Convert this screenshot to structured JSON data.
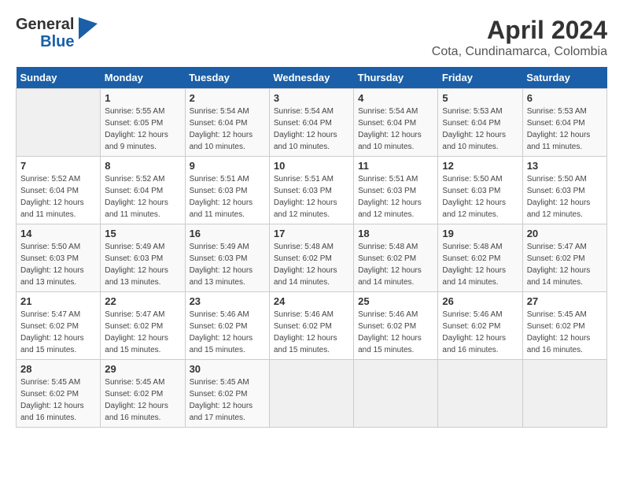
{
  "header": {
    "logo_general": "General",
    "logo_blue": "Blue",
    "month": "April 2024",
    "location": "Cota, Cundinamarca, Colombia"
  },
  "days_of_week": [
    "Sunday",
    "Monday",
    "Tuesday",
    "Wednesday",
    "Thursday",
    "Friday",
    "Saturday"
  ],
  "weeks": [
    [
      {
        "day": "",
        "sunrise": "",
        "sunset": "",
        "daylight": ""
      },
      {
        "day": "1",
        "sunrise": "5:55 AM",
        "sunset": "6:05 PM",
        "daylight": "12 hours and 9 minutes."
      },
      {
        "day": "2",
        "sunrise": "5:54 AM",
        "sunset": "6:04 PM",
        "daylight": "12 hours and 10 minutes."
      },
      {
        "day": "3",
        "sunrise": "5:54 AM",
        "sunset": "6:04 PM",
        "daylight": "12 hours and 10 minutes."
      },
      {
        "day": "4",
        "sunrise": "5:54 AM",
        "sunset": "6:04 PM",
        "daylight": "12 hours and 10 minutes."
      },
      {
        "day": "5",
        "sunrise": "5:53 AM",
        "sunset": "6:04 PM",
        "daylight": "12 hours and 10 minutes."
      },
      {
        "day": "6",
        "sunrise": "5:53 AM",
        "sunset": "6:04 PM",
        "daylight": "12 hours and 11 minutes."
      }
    ],
    [
      {
        "day": "7",
        "sunrise": "5:52 AM",
        "sunset": "6:04 PM",
        "daylight": "12 hours and 11 minutes."
      },
      {
        "day": "8",
        "sunrise": "5:52 AM",
        "sunset": "6:04 PM",
        "daylight": "12 hours and 11 minutes."
      },
      {
        "day": "9",
        "sunrise": "5:51 AM",
        "sunset": "6:03 PM",
        "daylight": "12 hours and 11 minutes."
      },
      {
        "day": "10",
        "sunrise": "5:51 AM",
        "sunset": "6:03 PM",
        "daylight": "12 hours and 12 minutes."
      },
      {
        "day": "11",
        "sunrise": "5:51 AM",
        "sunset": "6:03 PM",
        "daylight": "12 hours and 12 minutes."
      },
      {
        "day": "12",
        "sunrise": "5:50 AM",
        "sunset": "6:03 PM",
        "daylight": "12 hours and 12 minutes."
      },
      {
        "day": "13",
        "sunrise": "5:50 AM",
        "sunset": "6:03 PM",
        "daylight": "12 hours and 12 minutes."
      }
    ],
    [
      {
        "day": "14",
        "sunrise": "5:50 AM",
        "sunset": "6:03 PM",
        "daylight": "12 hours and 13 minutes."
      },
      {
        "day": "15",
        "sunrise": "5:49 AM",
        "sunset": "6:03 PM",
        "daylight": "12 hours and 13 minutes."
      },
      {
        "day": "16",
        "sunrise": "5:49 AM",
        "sunset": "6:03 PM",
        "daylight": "12 hours and 13 minutes."
      },
      {
        "day": "17",
        "sunrise": "5:48 AM",
        "sunset": "6:02 PM",
        "daylight": "12 hours and 14 minutes."
      },
      {
        "day": "18",
        "sunrise": "5:48 AM",
        "sunset": "6:02 PM",
        "daylight": "12 hours and 14 minutes."
      },
      {
        "day": "19",
        "sunrise": "5:48 AM",
        "sunset": "6:02 PM",
        "daylight": "12 hours and 14 minutes."
      },
      {
        "day": "20",
        "sunrise": "5:47 AM",
        "sunset": "6:02 PM",
        "daylight": "12 hours and 14 minutes."
      }
    ],
    [
      {
        "day": "21",
        "sunrise": "5:47 AM",
        "sunset": "6:02 PM",
        "daylight": "12 hours and 15 minutes."
      },
      {
        "day": "22",
        "sunrise": "5:47 AM",
        "sunset": "6:02 PM",
        "daylight": "12 hours and 15 minutes."
      },
      {
        "day": "23",
        "sunrise": "5:46 AM",
        "sunset": "6:02 PM",
        "daylight": "12 hours and 15 minutes."
      },
      {
        "day": "24",
        "sunrise": "5:46 AM",
        "sunset": "6:02 PM",
        "daylight": "12 hours and 15 minutes."
      },
      {
        "day": "25",
        "sunrise": "5:46 AM",
        "sunset": "6:02 PM",
        "daylight": "12 hours and 15 minutes."
      },
      {
        "day": "26",
        "sunrise": "5:46 AM",
        "sunset": "6:02 PM",
        "daylight": "12 hours and 16 minutes."
      },
      {
        "day": "27",
        "sunrise": "5:45 AM",
        "sunset": "6:02 PM",
        "daylight": "12 hours and 16 minutes."
      }
    ],
    [
      {
        "day": "28",
        "sunrise": "5:45 AM",
        "sunset": "6:02 PM",
        "daylight": "12 hours and 16 minutes."
      },
      {
        "day": "29",
        "sunrise": "5:45 AM",
        "sunset": "6:02 PM",
        "daylight": "12 hours and 16 minutes."
      },
      {
        "day": "30",
        "sunrise": "5:45 AM",
        "sunset": "6:02 PM",
        "daylight": "12 hours and 17 minutes."
      },
      {
        "day": "",
        "sunrise": "",
        "sunset": "",
        "daylight": ""
      },
      {
        "day": "",
        "sunrise": "",
        "sunset": "",
        "daylight": ""
      },
      {
        "day": "",
        "sunrise": "",
        "sunset": "",
        "daylight": ""
      },
      {
        "day": "",
        "sunrise": "",
        "sunset": "",
        "daylight": ""
      }
    ]
  ]
}
